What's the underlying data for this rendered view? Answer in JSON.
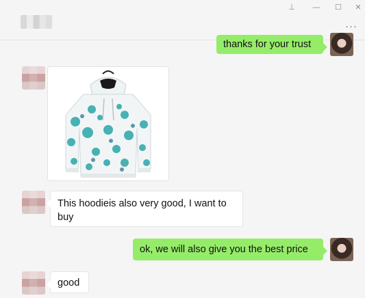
{
  "titlebar": {
    "pin_glyph": "⊥",
    "minimize_glyph": "—",
    "maximize_glyph": "☐",
    "close_glyph": "✕",
    "more_glyph": "···"
  },
  "messages": [
    {
      "id": "m1",
      "side": "right",
      "type": "text",
      "text": "thanks for your trust"
    },
    {
      "id": "m2",
      "side": "left",
      "type": "image",
      "image": "hoodie-photo"
    },
    {
      "id": "m3",
      "side": "left",
      "type": "text",
      "text": "This hoodieis also very good, I want to buy"
    },
    {
      "id": "m4",
      "side": "right",
      "type": "text",
      "text": "ok, we will also give you the best price"
    },
    {
      "id": "m5",
      "side": "left",
      "type": "text",
      "text": "good"
    }
  ],
  "colors": {
    "sent_bubble": "#95ec69",
    "received_bubble": "#ffffff",
    "background": "#f5f5f5",
    "hoodie_print": "#2aa6a8"
  }
}
